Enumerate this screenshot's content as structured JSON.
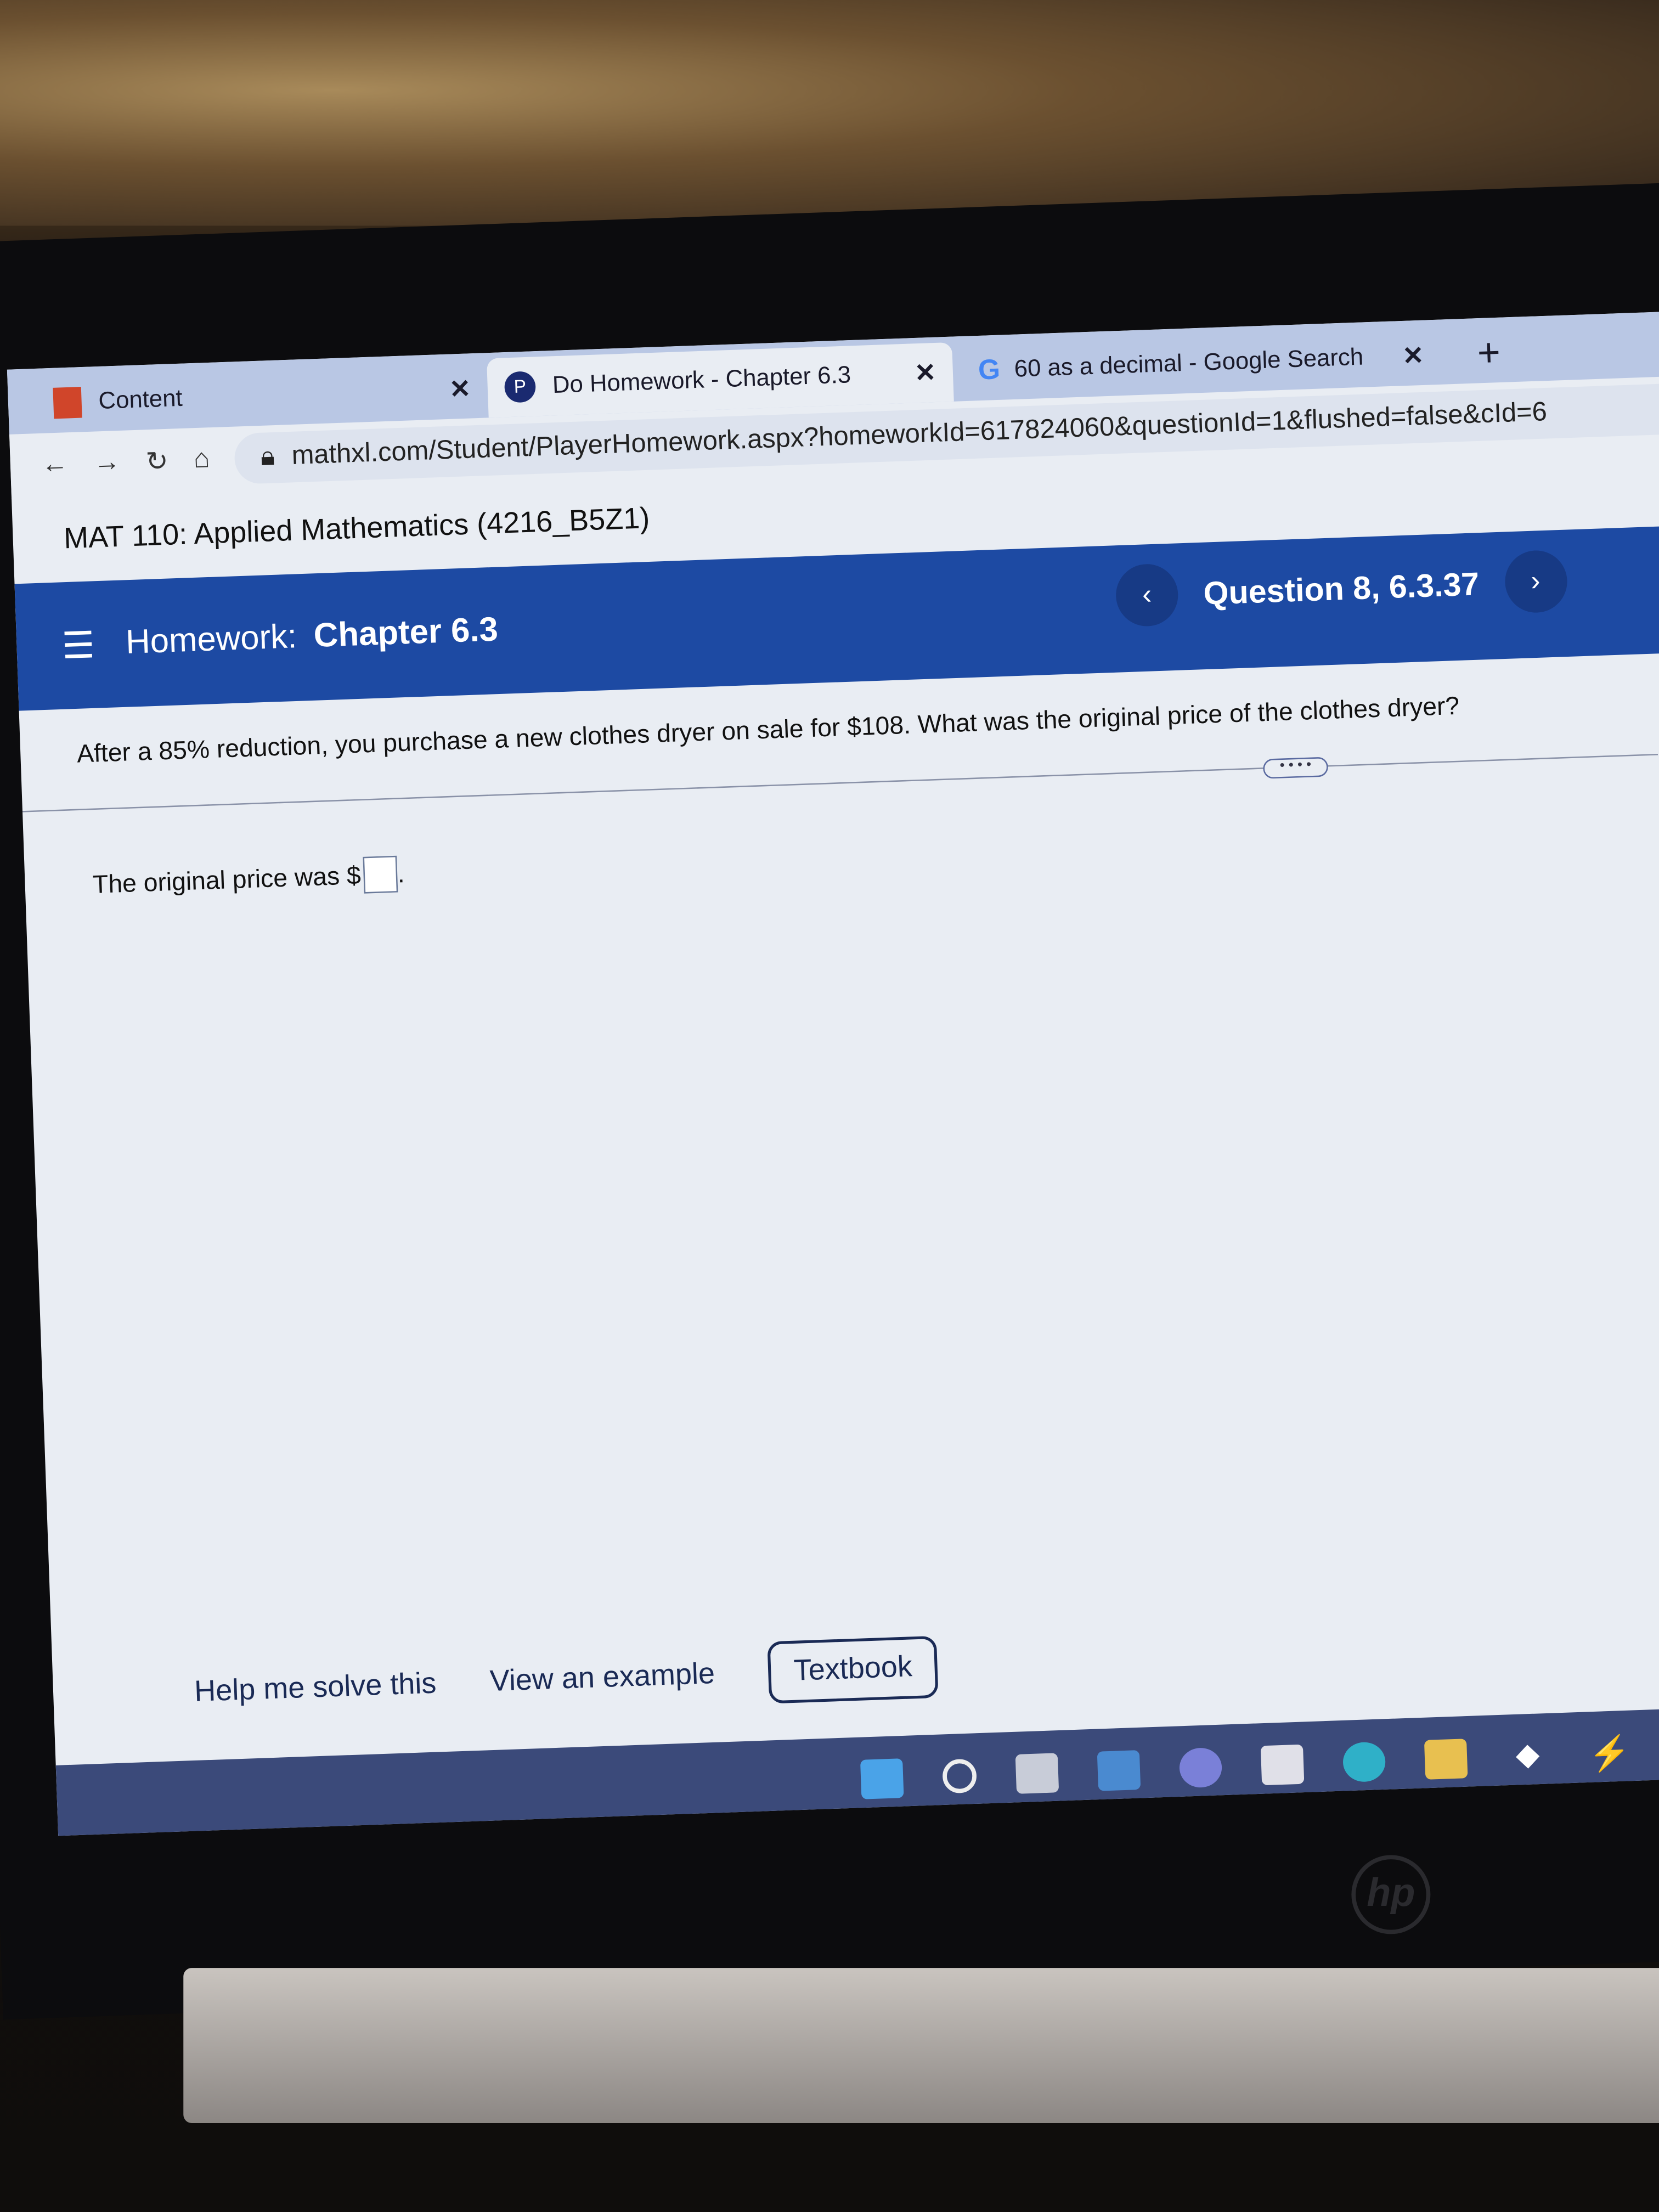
{
  "browser": {
    "tabs": [
      {
        "label": "Content",
        "icon": "content-app-icon",
        "active": false
      },
      {
        "label": "Do Homework - Chapter 6.3",
        "icon": "pearson-p-icon",
        "active": true
      },
      {
        "label": "60 as a decimal - Google Search",
        "icon": "google-g-icon",
        "active": false
      }
    ],
    "close_glyph": "✕",
    "new_tab_glyph": "+",
    "url": "mathxl.com/Student/PlayerHomework.aspx?homeworkId=617824060&questionId=1&flushed=false&cId=6"
  },
  "page": {
    "course_title": "MAT 110: Applied Mathematics (4216_B5Z1)",
    "homework_label": "Homework:",
    "homework_name": "Chapter 6.3",
    "question_label": "Question 8, 6.3.37",
    "question_text": "After a 85% reduction, you purchase a new clothes dryer on sale for $108.  What was the original price of the clothes dryer?",
    "more_label": "• • • •",
    "answer_prefix": "The original price was $",
    "answer_value": "",
    "answer_suffix": ".",
    "help_label": "Help me solve this",
    "example_label": "View an example",
    "textbook_label": "Textbook",
    "accent_color": "#1d4aa3"
  },
  "taskbar": {
    "icons": [
      "windows-start-icon",
      "search-icon",
      "task-view-icon",
      "widgets-icon",
      "teams-chat-icon",
      "store-icon",
      "edge-icon",
      "file-explorer-icon",
      "dropbox-icon",
      "app-icon"
    ]
  },
  "laptop": {
    "brand": "hp"
  }
}
